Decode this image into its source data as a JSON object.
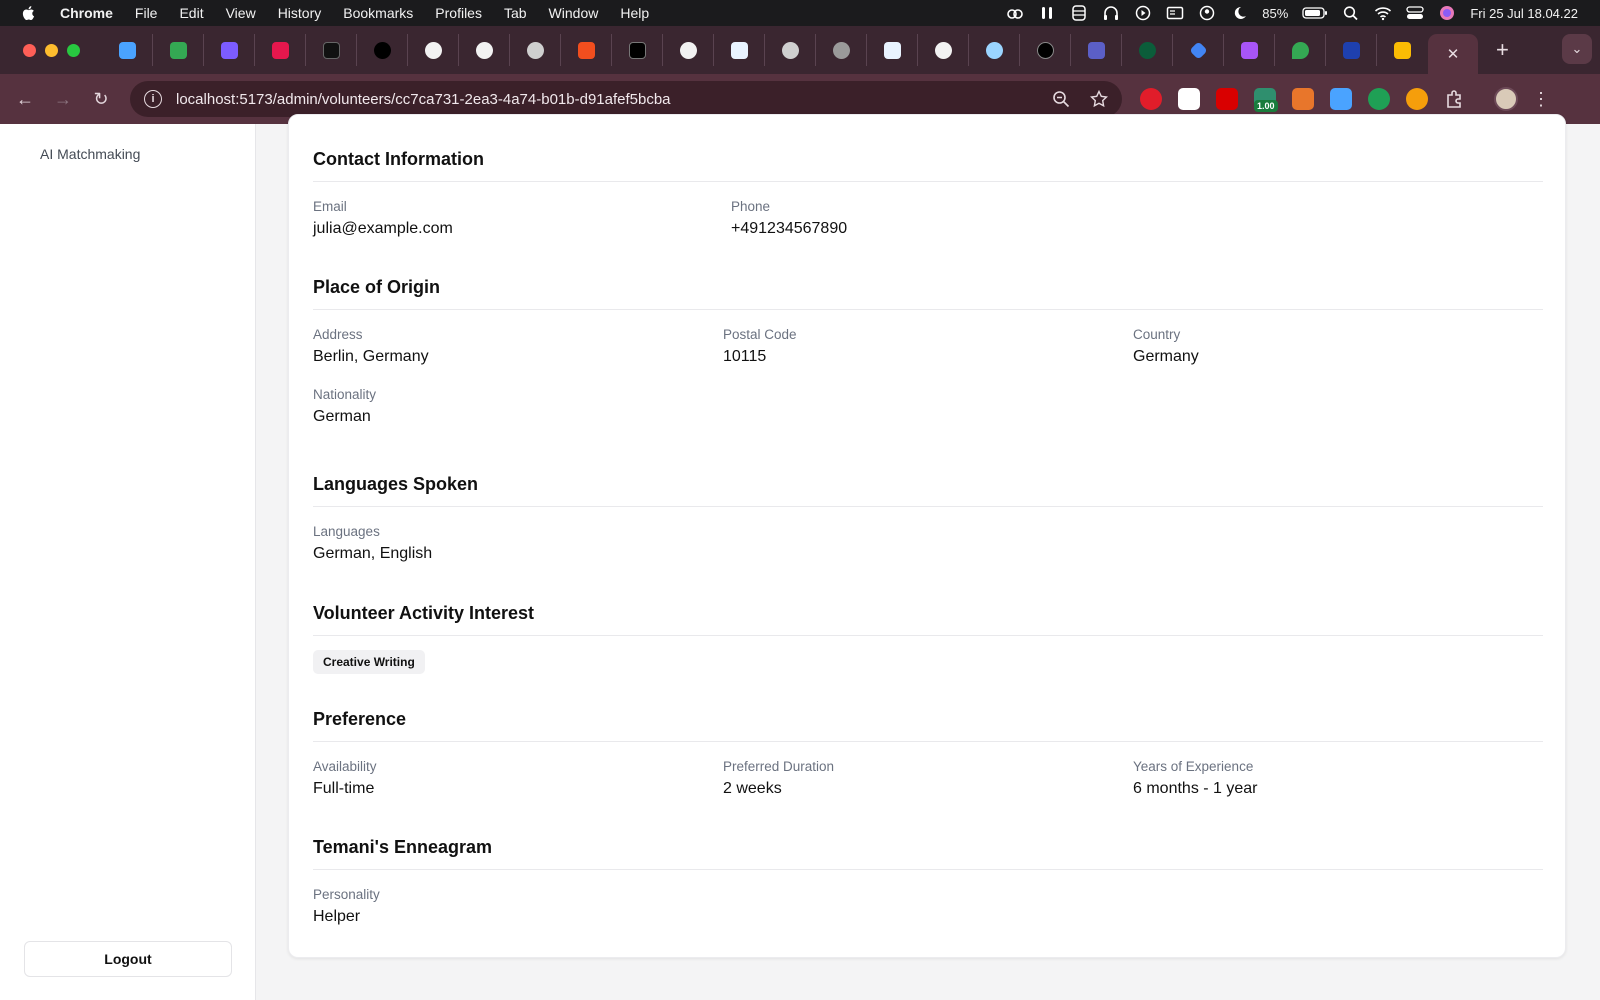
{
  "menubar": {
    "app": "Chrome",
    "items": [
      "File",
      "Edit",
      "View",
      "History",
      "Bookmarks",
      "Profiles",
      "Tab",
      "Window",
      "Help"
    ],
    "battery": "85%",
    "datetime": "Fri 25 Jul  18.04.22"
  },
  "browser": {
    "url": "localhost:5173/admin/volunteers/cc7ca731-2ea3-4a74-b01b-d91afef5bcba",
    "extension_badge": "1.00",
    "active_tab_close": "✕",
    "new_tab": "+"
  },
  "sidebar": {
    "nav_item": "AI Matchmaking",
    "logout": "Logout"
  },
  "profile": {
    "contact": {
      "title": "Contact Information",
      "email_label": "Email",
      "email": "julia@example.com",
      "phone_label": "Phone",
      "phone": "+491234567890"
    },
    "origin": {
      "title": "Place of Origin",
      "address_label": "Address",
      "address": "Berlin, Germany",
      "postal_label": "Postal Code",
      "postal": "10115",
      "country_label": "Country",
      "country": "Germany",
      "nationality_label": "Nationality",
      "nationality": "German"
    },
    "languages": {
      "title": "Languages Spoken",
      "label": "Languages",
      "value": "German, English"
    },
    "interest": {
      "title": "Volunteer Activity Interest",
      "chip": "Creative Writing"
    },
    "preference": {
      "title": "Preference",
      "availability_label": "Availability",
      "availability": "Full-time",
      "duration_label": "Preferred Duration",
      "duration": "2 weeks",
      "experience_label": "Years of Experience",
      "experience": "6 months - 1 year"
    },
    "enneagram": {
      "title": "Temani's Enneagram",
      "label": "Personality",
      "value": "Helper"
    }
  },
  "colors": {
    "tabstrip": "#3a2630",
    "toolbar": "#56323f",
    "omnibox": "#3b2029",
    "page_bg": "#f4f4f5"
  }
}
